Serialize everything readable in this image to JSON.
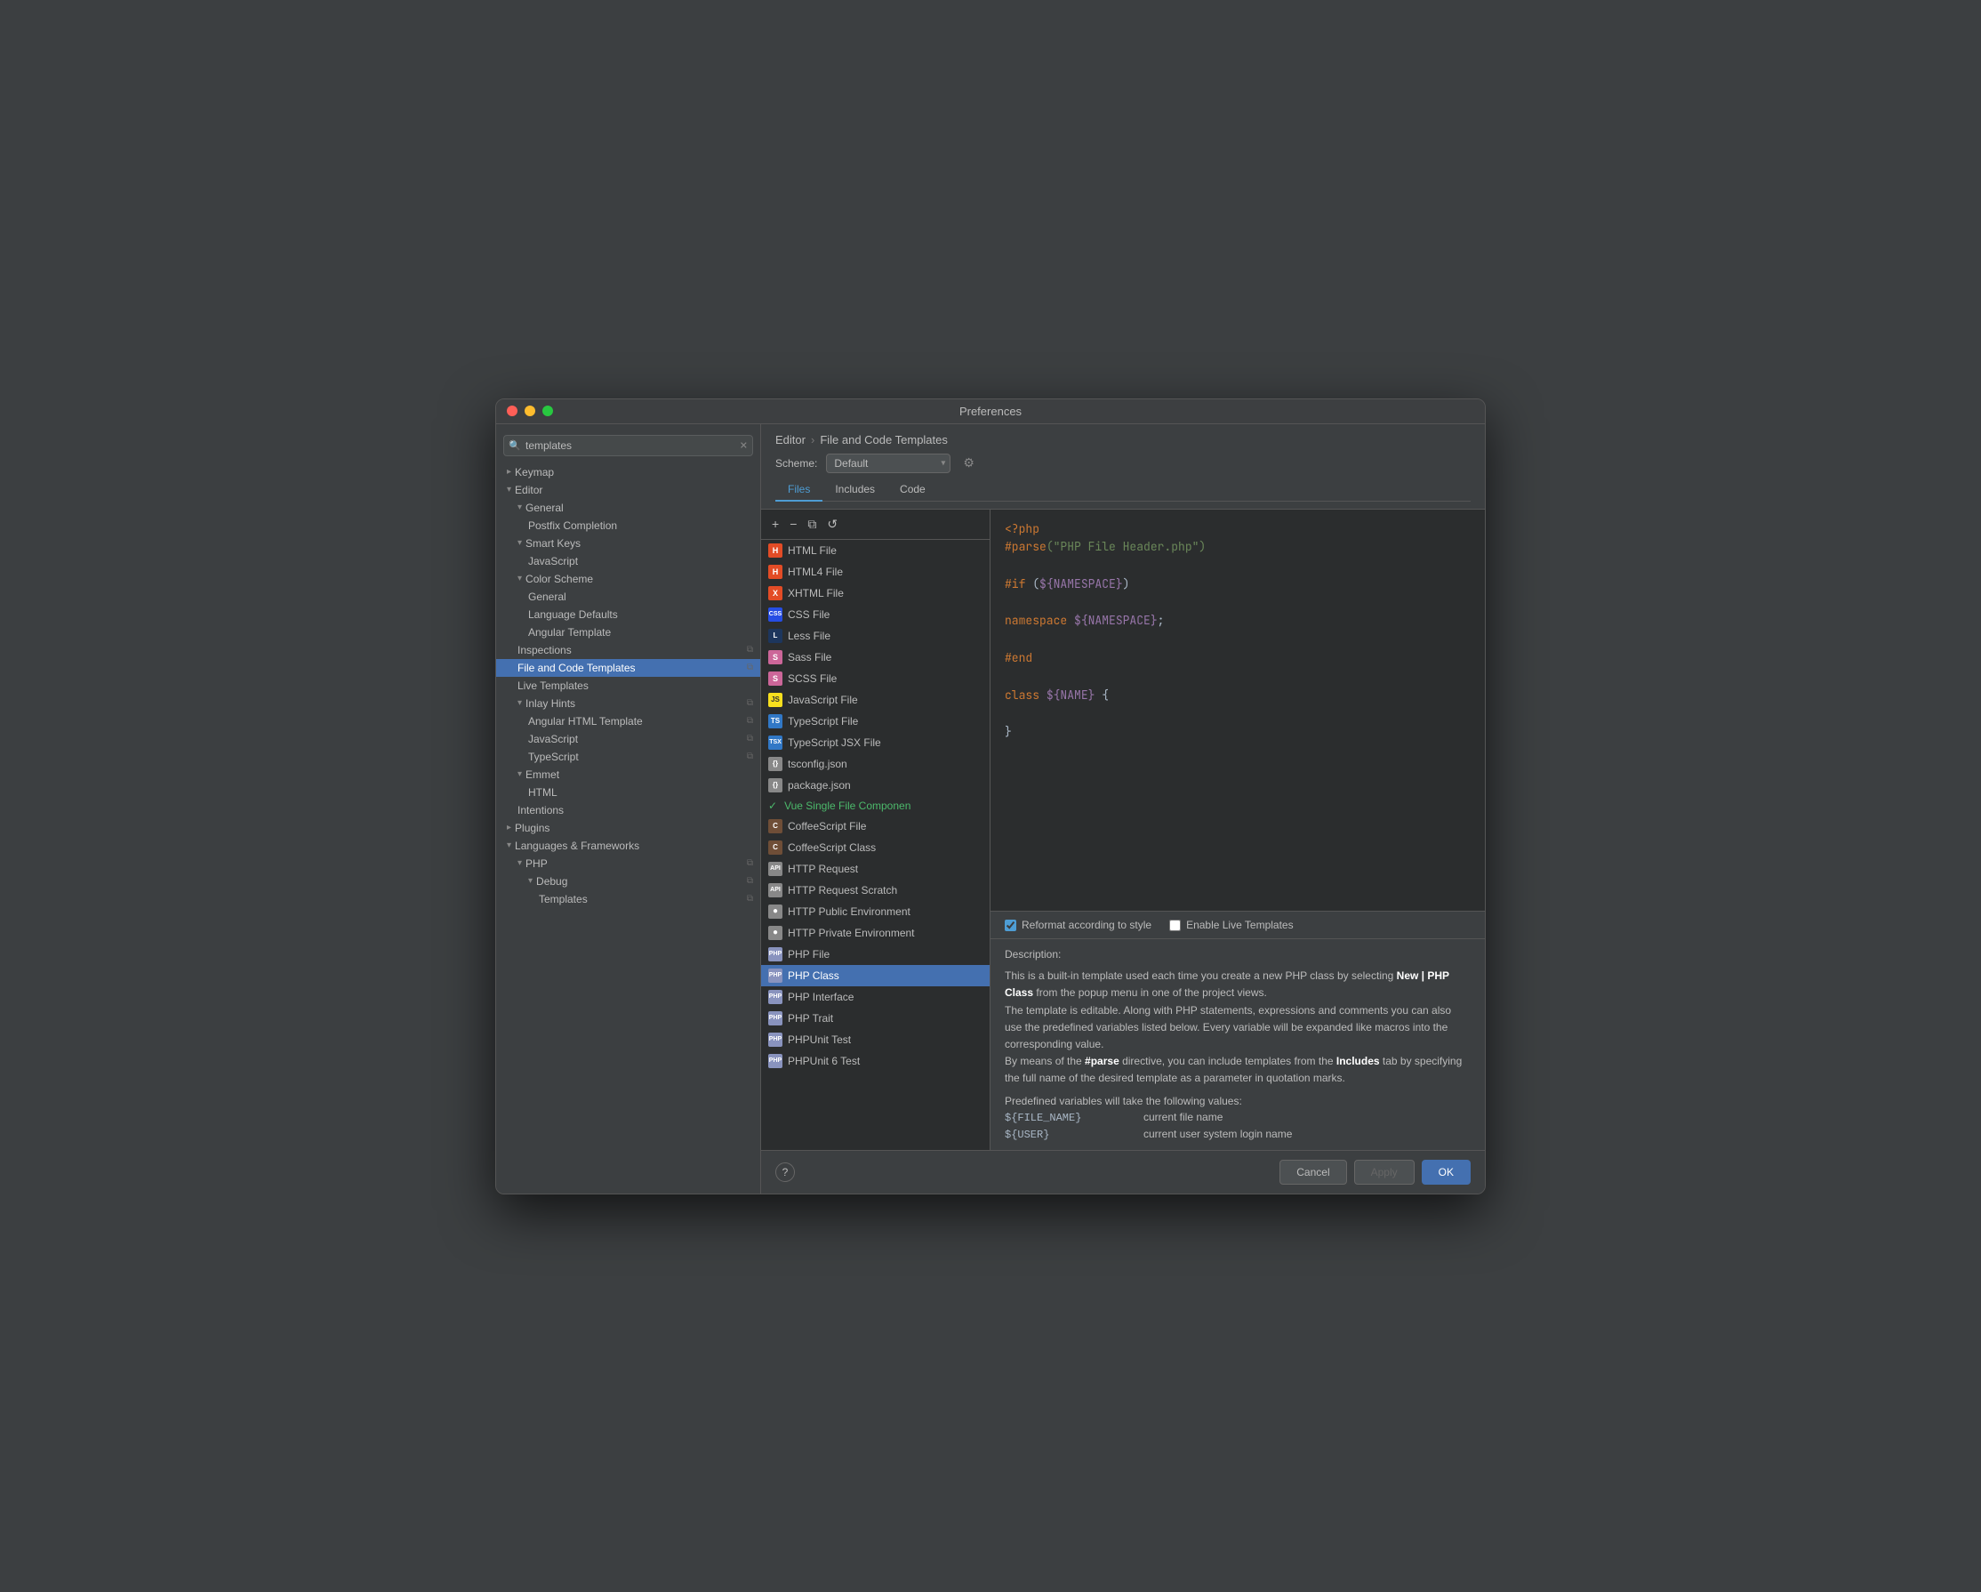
{
  "window": {
    "title": "Preferences"
  },
  "sidebar": {
    "search_placeholder": "templates",
    "items": [
      {
        "id": "keymap",
        "label": "Keymap",
        "level": 0,
        "type": "group",
        "expanded": false
      },
      {
        "id": "editor",
        "label": "Editor",
        "level": 0,
        "type": "group",
        "expanded": true
      },
      {
        "id": "general",
        "label": "General",
        "level": 1,
        "type": "group",
        "expanded": true
      },
      {
        "id": "postfix-completion",
        "label": "Postfix Completion",
        "level": 2,
        "type": "item"
      },
      {
        "id": "smart-keys",
        "label": "Smart Keys",
        "level": 1,
        "type": "group",
        "expanded": true
      },
      {
        "id": "javascript",
        "label": "JavaScript",
        "level": 2,
        "type": "item"
      },
      {
        "id": "color-scheme",
        "label": "Color Scheme",
        "level": 1,
        "type": "group",
        "expanded": true
      },
      {
        "id": "color-scheme-general",
        "label": "General",
        "level": 2,
        "type": "item"
      },
      {
        "id": "language-defaults",
        "label": "Language Defaults",
        "level": 2,
        "type": "item"
      },
      {
        "id": "angular-template",
        "label": "Angular Template",
        "level": 2,
        "type": "item"
      },
      {
        "id": "inspections",
        "label": "Inspections",
        "level": 1,
        "type": "item",
        "has_copy": true
      },
      {
        "id": "file-and-code-templates",
        "label": "File and Code Templates",
        "level": 1,
        "type": "item",
        "active": true,
        "has_copy": true
      },
      {
        "id": "live-templates",
        "label": "Live Templates",
        "level": 1,
        "type": "item"
      },
      {
        "id": "inlay-hints",
        "label": "Inlay Hints",
        "level": 1,
        "type": "group",
        "expanded": true
      },
      {
        "id": "angular-html-template",
        "label": "Angular HTML Template",
        "level": 2,
        "type": "item",
        "has_copy": true
      },
      {
        "id": "inlay-javascript",
        "label": "JavaScript",
        "level": 2,
        "type": "item",
        "has_copy": true
      },
      {
        "id": "typescript",
        "label": "TypeScript",
        "level": 2,
        "type": "item",
        "has_copy": true
      },
      {
        "id": "emmet",
        "label": "Emmet",
        "level": 1,
        "type": "group",
        "expanded": true
      },
      {
        "id": "html",
        "label": "HTML",
        "level": 2,
        "type": "item"
      },
      {
        "id": "intentions",
        "label": "Intentions",
        "level": 1,
        "type": "item"
      },
      {
        "id": "plugins",
        "label": "Plugins",
        "level": 0,
        "type": "group",
        "expanded": false
      },
      {
        "id": "languages-frameworks",
        "label": "Languages & Frameworks",
        "level": 0,
        "type": "group",
        "expanded": true
      },
      {
        "id": "php",
        "label": "PHP",
        "level": 1,
        "type": "group",
        "expanded": true,
        "has_copy": true
      },
      {
        "id": "debug",
        "label": "Debug",
        "level": 2,
        "type": "group",
        "expanded": true,
        "has_copy": true
      },
      {
        "id": "templates",
        "label": "Templates",
        "level": 3,
        "type": "item",
        "has_copy": true
      }
    ]
  },
  "panel": {
    "breadcrumb_editor": "Editor",
    "breadcrumb_sep": "›",
    "breadcrumb_current": "File and Code Templates",
    "scheme_label": "Scheme:",
    "scheme_value": "Default",
    "tabs": [
      "Files",
      "Includes",
      "Code"
    ],
    "active_tab": "Files"
  },
  "toolbar": {
    "add_label": "+",
    "remove_label": "−",
    "copy_label": "⧉",
    "reset_label": "↺"
  },
  "template_list": [
    {
      "id": "html-file",
      "label": "HTML File",
      "icon_type": "html",
      "icon_label": "H"
    },
    {
      "id": "html4-file",
      "label": "HTML4 File",
      "icon_type": "html4",
      "icon_label": "H"
    },
    {
      "id": "xhtml-file",
      "label": "XHTML File",
      "icon_type": "xhtml",
      "icon_label": "X"
    },
    {
      "id": "css-file",
      "label": "CSS File",
      "icon_type": "css",
      "icon_label": "CSS"
    },
    {
      "id": "less-file",
      "label": "Less File",
      "icon_type": "less",
      "icon_label": "L"
    },
    {
      "id": "sass-file",
      "label": "Sass File",
      "icon_type": "sass",
      "icon_label": "S"
    },
    {
      "id": "scss-file",
      "label": "SCSS File",
      "icon_type": "scss",
      "icon_label": "S"
    },
    {
      "id": "javascript-file",
      "label": "JavaScript File",
      "icon_type": "js",
      "icon_label": "JS"
    },
    {
      "id": "typescript-file",
      "label": "TypeScript File",
      "icon_type": "ts",
      "icon_label": "TS"
    },
    {
      "id": "typescript-jsx-file",
      "label": "TypeScript JSX File",
      "icon_type": "tsxjsx",
      "icon_label": "TS"
    },
    {
      "id": "tsconfig-json",
      "label": "tsconfig.json",
      "icon_type": "json",
      "icon_label": "{}"
    },
    {
      "id": "package-json",
      "label": "package.json",
      "icon_type": "json",
      "icon_label": "{}"
    },
    {
      "id": "vue-single-file",
      "label": "Vue Single File Componen",
      "icon_type": "vue",
      "icon_label": "V",
      "special": "vue"
    },
    {
      "id": "coffeescript-file",
      "label": "CoffeeScript File",
      "icon_type": "coffee",
      "icon_label": "C"
    },
    {
      "id": "coffeescript-class",
      "label": "CoffeeScript Class",
      "icon_type": "coffee",
      "icon_label": "C"
    },
    {
      "id": "http-request",
      "label": "HTTP Request",
      "icon_type": "http",
      "icon_label": "API"
    },
    {
      "id": "http-request-scratch",
      "label": "HTTP Request Scratch",
      "icon_type": "http",
      "icon_label": "API"
    },
    {
      "id": "http-public-env",
      "label": "HTTP Public Environment",
      "icon_type": "http",
      "icon_label": "●"
    },
    {
      "id": "http-private-env",
      "label": "HTTP Private Environment",
      "icon_type": "http",
      "icon_label": "●"
    },
    {
      "id": "php-file",
      "label": "PHP File",
      "icon_type": "php",
      "icon_label": "PHP"
    },
    {
      "id": "php-class",
      "label": "PHP Class",
      "icon_type": "php",
      "icon_label": "PHP",
      "selected": true
    },
    {
      "id": "php-interface",
      "label": "PHP Interface",
      "icon_type": "php",
      "icon_label": "PHP"
    },
    {
      "id": "php-trait",
      "label": "PHP Trait",
      "icon_type": "php",
      "icon_label": "PHP"
    },
    {
      "id": "phpunit-test",
      "label": "PHPUnit Test",
      "icon_type": "phpunit",
      "icon_label": "PHP"
    },
    {
      "id": "phpunit-6-test",
      "label": "PHPUnit 6 Test",
      "icon_type": "phpunit",
      "icon_label": "PHP"
    }
  ],
  "code_content": {
    "line1": "<?php",
    "line2_prefix": "#parse",
    "line2_str": "(\"PHP File Header.php\")",
    "line3_blank": "",
    "line4_kw": "#if",
    "line4_var": "(${NAMESPACE})",
    "line5_blank": "",
    "line6_kw": "namespace",
    "line6_var": "${NAMESPACE};",
    "line7_blank": "",
    "line8_kw": "#end",
    "line9_blank": "",
    "line10_kw": "class",
    "line10_var": "${NAME}",
    "line10_rest": " {",
    "line11_blank": "",
    "line12": "}"
  },
  "options": {
    "reformat_label": "Reformat according to style",
    "reformat_checked": true,
    "live_templates_label": "Enable Live Templates",
    "live_templates_checked": false
  },
  "description": {
    "title": "Description:",
    "text_p1": "This is a built-in template used each time you create a new PHP class by selecting ",
    "text_bold1": "New | PHP Class",
    "text_p2": " from the popup menu in one of the project views.",
    "text_p3": "The template is editable. Along with PHP statements, expressions and comments you can also use the predefined variables listed below. Every variable will be expanded like macros into the corresponding value.",
    "text_p4_prefix": "By means of the ",
    "text_bold2": "#parse",
    "text_p4_mid": " directive, you can include templates from the ",
    "text_bold3": "Includes",
    "text_p4_suffix": " tab by specifying the full name of the desired template as a parameter in quotation marks.",
    "predefined_label": "Predefined variables will take the following values:",
    "vars": [
      {
        "name": "${FILE_NAME}",
        "desc": "current file name"
      },
      {
        "name": "${USER}",
        "desc": "current user system login name"
      }
    ]
  },
  "buttons": {
    "cancel": "Cancel",
    "apply": "Apply",
    "ok": "OK",
    "help": "?"
  }
}
